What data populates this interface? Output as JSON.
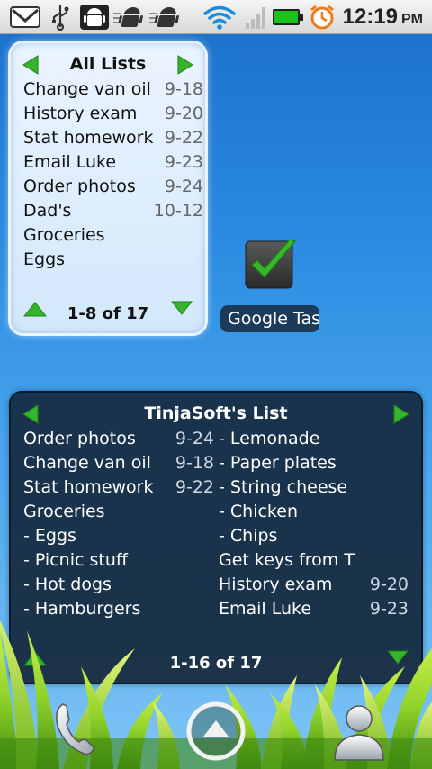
{
  "status_bar": {
    "time": "12:19",
    "ampm": "PM",
    "icons": [
      "gmail-icon",
      "usb-icon",
      "android-debug-icon",
      "android-icon",
      "android-icon",
      "wifi-icon",
      "signal-icon",
      "battery-icon",
      "alarm-icon"
    ],
    "colors": {
      "battery": "#19c519",
      "alarm": "#f07a1a"
    }
  },
  "widget_light": {
    "title": "All Lists",
    "items": [
      {
        "text": "Change van oil",
        "date": "9-18"
      },
      {
        "text": "History exam",
        "date": "9-20"
      },
      {
        "text": "Stat homework",
        "date": "9-22"
      },
      {
        "text": "Email Luke",
        "date": "9-23"
      },
      {
        "text": "Order photos",
        "date": "9-24"
      },
      {
        "text": "Dad's",
        "date": "10-12"
      },
      {
        "text": "Groceries",
        "date": ""
      },
      {
        "text": "Eggs",
        "date": ""
      }
    ],
    "footer": "1-8 of 17"
  },
  "shortcut": {
    "label": "Google Tasks",
    "icon": "checkmark-icon"
  },
  "widget_dark": {
    "title": "TinjaSoft's List",
    "left_items": [
      {
        "text": "Order photos",
        "date": "9-24"
      },
      {
        "text": "Change van oil",
        "date": "9-18"
      },
      {
        "text": "Stat homework",
        "date": "9-22"
      },
      {
        "text": "Groceries",
        "date": ""
      },
      {
        "text": " - Eggs",
        "date": ""
      },
      {
        "text": " - Picnic stuff",
        "date": ""
      },
      {
        "text": " - Hot dogs",
        "date": ""
      },
      {
        "text": " - Hamburgers",
        "date": ""
      }
    ],
    "right_items": [
      {
        "text": " - Lemonade",
        "date": ""
      },
      {
        "text": " - Paper plates",
        "date": ""
      },
      {
        "text": " - String cheese",
        "date": ""
      },
      {
        "text": " - Chicken",
        "date": ""
      },
      {
        "text": " - Chips",
        "date": ""
      },
      {
        "text": "Get keys from T",
        "date": ""
      },
      {
        "text": "History exam",
        "date": "9-20"
      },
      {
        "text": "Email Luke",
        "date": "9-23"
      }
    ],
    "footer": "1-16 of 17"
  },
  "dock": {
    "items": [
      "phone-icon",
      "launcher-icon",
      "contacts-icon"
    ]
  },
  "colors": {
    "nav_arrow": "#35b52a",
    "sky": "#2a8ae0",
    "grass": "#8fd12a"
  }
}
